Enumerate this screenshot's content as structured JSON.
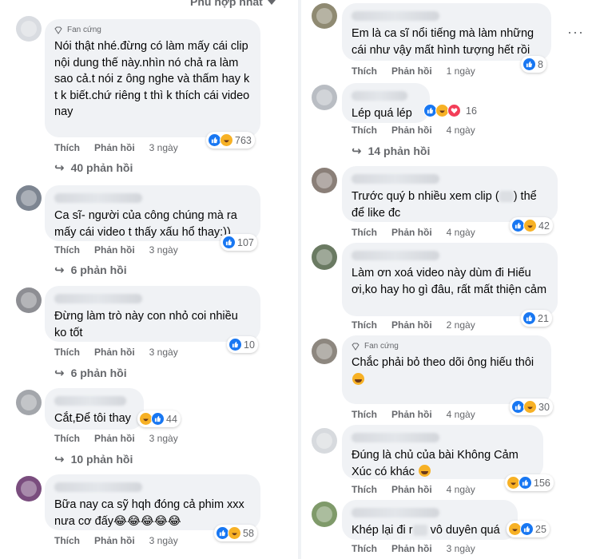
{
  "sort": {
    "label": "Phù hợp nhất"
  },
  "left": [
    {
      "badge": "Fan cứng",
      "text": "Nói thật nhé.đừng có làm mấy cái clip nội dung thế này.nhìn nó chả ra làm sao cả.t nói z ông nghe và thấm hay k t k biết.chứ riêng t thì k thích cái video nay",
      "reactions_count": "763",
      "like": "Thích",
      "reply": "Phản hồi",
      "time": "3 ngày",
      "replies": "40 phản hồi"
    },
    {
      "text": "Ca sĩ- người của công chúng mà ra mấy cái video t thấy xấu hổ thay:))",
      "reactions_count": "107",
      "like": "Thích",
      "reply": "Phản hồi",
      "time": "3 ngày",
      "replies": "6 phản hồi"
    },
    {
      "text": "Đừng làm trò này con nhỏ coi nhiều ko tốt",
      "reactions_count": "10",
      "like": "Thích",
      "reply": "Phản hồi",
      "time": "3 ngày",
      "replies": "6 phản hồi"
    },
    {
      "text": "Cắt,Để tôi thay",
      "reactions_count": "44",
      "like": "Thích",
      "reply": "Phản hồi",
      "time": "3 ngày",
      "replies": "10 phản hồi"
    },
    {
      "text": "Bữa nay ca sỹ hqh đóng cả phim xxx nưa cơ đấy😂😂😂😂😂",
      "reactions_count": "58",
      "like": "Thích",
      "reply": "Phản hồi",
      "time": "3 ngày"
    }
  ],
  "right": [
    {
      "text": "Em là ca sĩ nổi tiếng mà làm những cái như vậy mất hình tượng hết rồi",
      "reactions_count": "8",
      "like": "Thích",
      "reply": "Phản hồi",
      "time": "1 ngày"
    },
    {
      "text": "Lép quá lép",
      "reactions_count": "16",
      "like": "Thích",
      "reply": "Phản hồi",
      "time": "4 ngày",
      "replies": "14 phản hồi"
    },
    {
      "text_a": "Trước quý b nhiều xem clip (",
      "text_b": ") thể để like đc",
      "reactions_count": "42",
      "like": "Thích",
      "reply": "Phản hồi",
      "time": "4 ngày"
    },
    {
      "text": "Làm ơn xoá video này dùm đi Hiếu ơi,ko hay ho gì đâu, rất mất thiện cảm",
      "reactions_count": "21",
      "like": "Thích",
      "reply": "Phản hồi",
      "time": "2 ngày"
    },
    {
      "badge": "Fan cứng",
      "text": "Chắc phải bỏ theo dõi ông hiếu thôi",
      "reactions_count": "30",
      "like": "Thích",
      "reply": "Phản hồi",
      "time": "4 ngày"
    },
    {
      "text": "Đúng là chủ của bài Không Cảm Xúc có khác",
      "reactions_count": "156",
      "like": "Thích",
      "reply": "Phản hồi",
      "time": "4 ngày"
    },
    {
      "text_a": "Khép lại đi r",
      "text_b": " vô duyên quá",
      "reactions_count": "25",
      "like": "Thích",
      "reply": "Phản hồi",
      "time": "3 ngày"
    }
  ]
}
